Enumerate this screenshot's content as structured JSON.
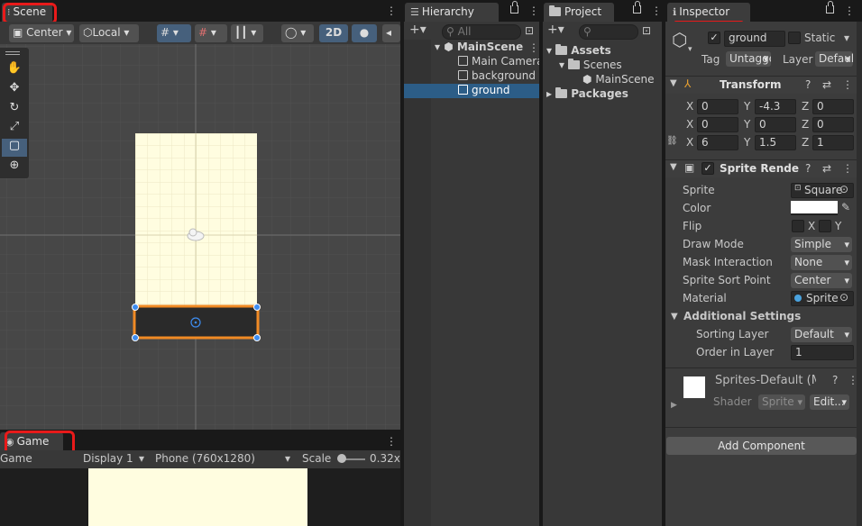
{
  "scene": {
    "tab": "Scene",
    "pivot": "Center",
    "space": "Local",
    "mode_2d": "2D"
  },
  "game": {
    "tab": "Game",
    "view": "Game",
    "display": "Display 1",
    "resolution": "Phone (760x1280)",
    "scale_label": "Scale",
    "scale_value": "0.32x"
  },
  "hierarchy": {
    "tab": "Hierarchy",
    "search_placeholder": "All",
    "items": [
      {
        "label": "MainScene"
      },
      {
        "label": "Main Camera"
      },
      {
        "label": "background"
      },
      {
        "label": "ground"
      }
    ]
  },
  "project": {
    "tab": "Project",
    "items": [
      {
        "label": "Assets"
      },
      {
        "label": "Scenes"
      },
      {
        "label": "MainScene"
      },
      {
        "label": "Packages"
      }
    ]
  },
  "inspector": {
    "tab": "Inspector",
    "object_name": "ground",
    "static_label": "Static",
    "tag_label": "Tag",
    "tag_value": "Untagged",
    "layer_label": "Layer",
    "layer_value": "Default",
    "transform": {
      "title": "Transform",
      "position": {
        "x": "0",
        "y": "-4.3",
        "z": "0"
      },
      "rotation": {
        "x": "0",
        "y": "0",
        "z": "0"
      },
      "scale": {
        "x": "6",
        "y": "1.5",
        "z": "1"
      },
      "axis_x": "X",
      "axis_y": "Y",
      "axis_z": "Z"
    },
    "sprite_renderer": {
      "title": "Sprite Renderer",
      "sprite_label": "Sprite",
      "sprite_value": "Square",
      "color_label": "Color",
      "color_value": "#ffffff",
      "flip_label": "Flip",
      "flip_x": "X",
      "flip_y": "Y",
      "draw_mode_label": "Draw Mode",
      "draw_mode_value": "Simple",
      "mask_label": "Mask Interaction",
      "mask_value": "None",
      "sort_point_label": "Sprite Sort Point",
      "sort_point_value": "Center",
      "material_label": "Material",
      "material_value": "Sprite",
      "additional_settings": "Additional Settings",
      "sorting_layer_label": "Sorting Layer",
      "sorting_layer_value": "Default",
      "order_label": "Order in Layer",
      "order_value": "1"
    },
    "material": {
      "name": "Sprites-Default (Material)",
      "shader_label": "Shader",
      "shader_value": "Sprite",
      "edit_label": "Edit..."
    },
    "add_component": "Add Component"
  },
  "colors": {
    "accent_annotation": "#e81a1a",
    "selection": "#2c5d87",
    "scene_bg": "#474747",
    "background_sprite": "#fffde0",
    "ground_sprite": "#2a2a2a",
    "gizmo_orange": "#f08a24"
  }
}
